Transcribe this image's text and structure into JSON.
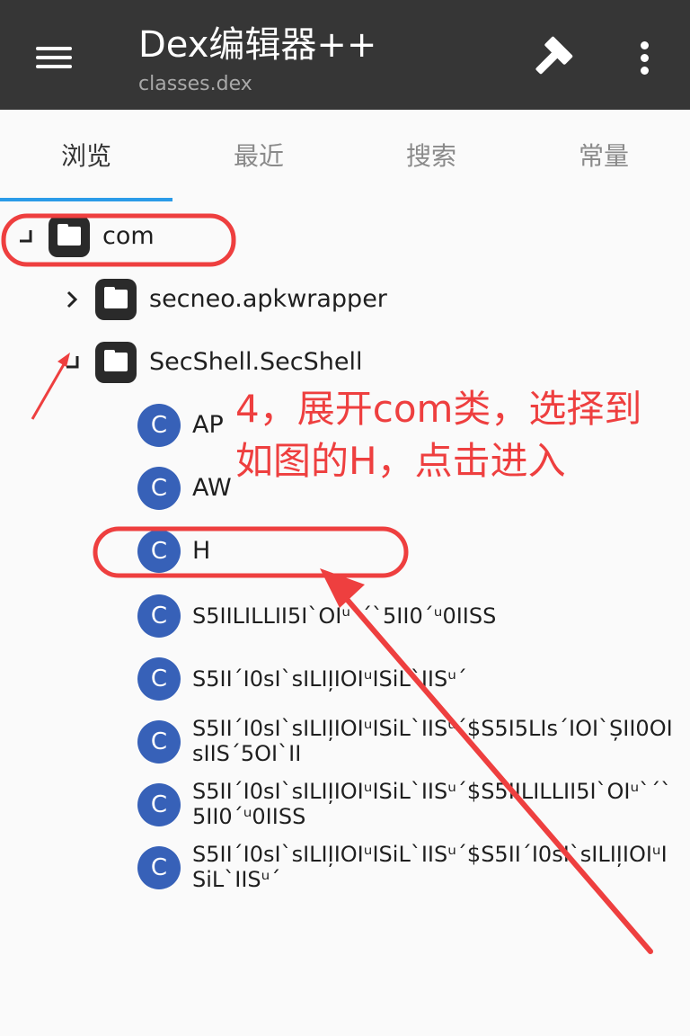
{
  "app": {
    "title": "Dex编辑器++",
    "subtitle": "classes.dex",
    "icons": {
      "menu": "menu-icon",
      "build": "hammer-icon",
      "more": "more-vert-icon"
    }
  },
  "tabs": [
    {
      "label": "浏览",
      "active": true
    },
    {
      "label": "最近",
      "active": false
    },
    {
      "label": "搜索",
      "active": false
    },
    {
      "label": "常量",
      "active": false
    }
  ],
  "tree": {
    "root": {
      "label": "com",
      "expanded": true
    },
    "packages": [
      {
        "label": "secneo.apkwrapper",
        "expanded": false
      },
      {
        "label": "SecShell.SecShell",
        "expanded": true
      }
    ],
    "class_icon_letter": "C",
    "classes": [
      {
        "label": "AP"
      },
      {
        "label": "AW"
      },
      {
        "label": "H"
      },
      {
        "label": "S5IILILLII5I`OIᵘ`´`5II0´ᵘ0IISS"
      },
      {
        "label": "S5II´I0sI`sILII̦IOIᵘISiL`IISᵘ´"
      },
      {
        "label": "S5II´I0sI`sILII̦IOIᵘISiL`IISᵘ´$S5I5LIs´IOI`ȘII0OIsIIS´5OI`II"
      },
      {
        "label": "S5II´I0sI`sILII̦IOIᵘISiL`IISᵘ´$S5IILILLII5I`OIᵘ`´`5II0´ᵘ0IISS"
      },
      {
        "label": "S5II´I0sI`sILII̦IOIᵘISiL`IISᵘ´$S5II´I0sI`sILII̦IOIᵘISiL`IISᵘ´"
      }
    ]
  },
  "annotation": {
    "text": "4，展开com类，选择到如图的H，点击进入",
    "color": "#ee3f3f"
  },
  "colors": {
    "appbar": "#363636",
    "accent": "#2b9be8",
    "class_icon": "#3761b8",
    "highlight": "#ee3f3f"
  }
}
